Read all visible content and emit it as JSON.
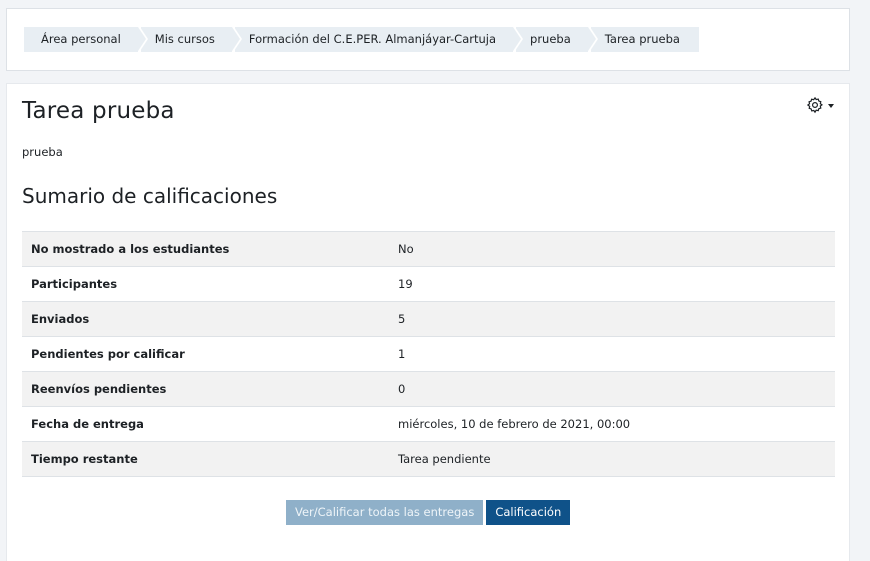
{
  "breadcrumb": {
    "items": [
      "Área personal",
      "Mis cursos",
      "Formación del C.E.PER. Almanjáyar-Cartuja",
      "prueba",
      "Tarea prueba"
    ]
  },
  "page": {
    "title": "Tarea prueba",
    "intro": "prueba",
    "settings_icon": "gear-icon"
  },
  "summary": {
    "heading": "Sumario de calificaciones",
    "rows": [
      {
        "label": "No mostrado a los estudiantes",
        "value": "No"
      },
      {
        "label": "Participantes",
        "value": "19"
      },
      {
        "label": "Enviados",
        "value": "5"
      },
      {
        "label": "Pendientes por calificar",
        "value": "1"
      },
      {
        "label": "Reenvíos pendientes",
        "value": "0"
      },
      {
        "label": "Fecha de entrega",
        "value": "miércoles, 10 de febrero de 2021, 00:00"
      },
      {
        "label": "Tiempo restante",
        "value": "Tarea pendiente"
      }
    ]
  },
  "actions": {
    "view_all_label": "Ver/Calificar todas las entregas",
    "grade_label": "Calificación"
  },
  "colors": {
    "primary": "#0f5289",
    "primary_light": "#8fb0c9",
    "breadcrumb_bg": "#e8eef3"
  }
}
